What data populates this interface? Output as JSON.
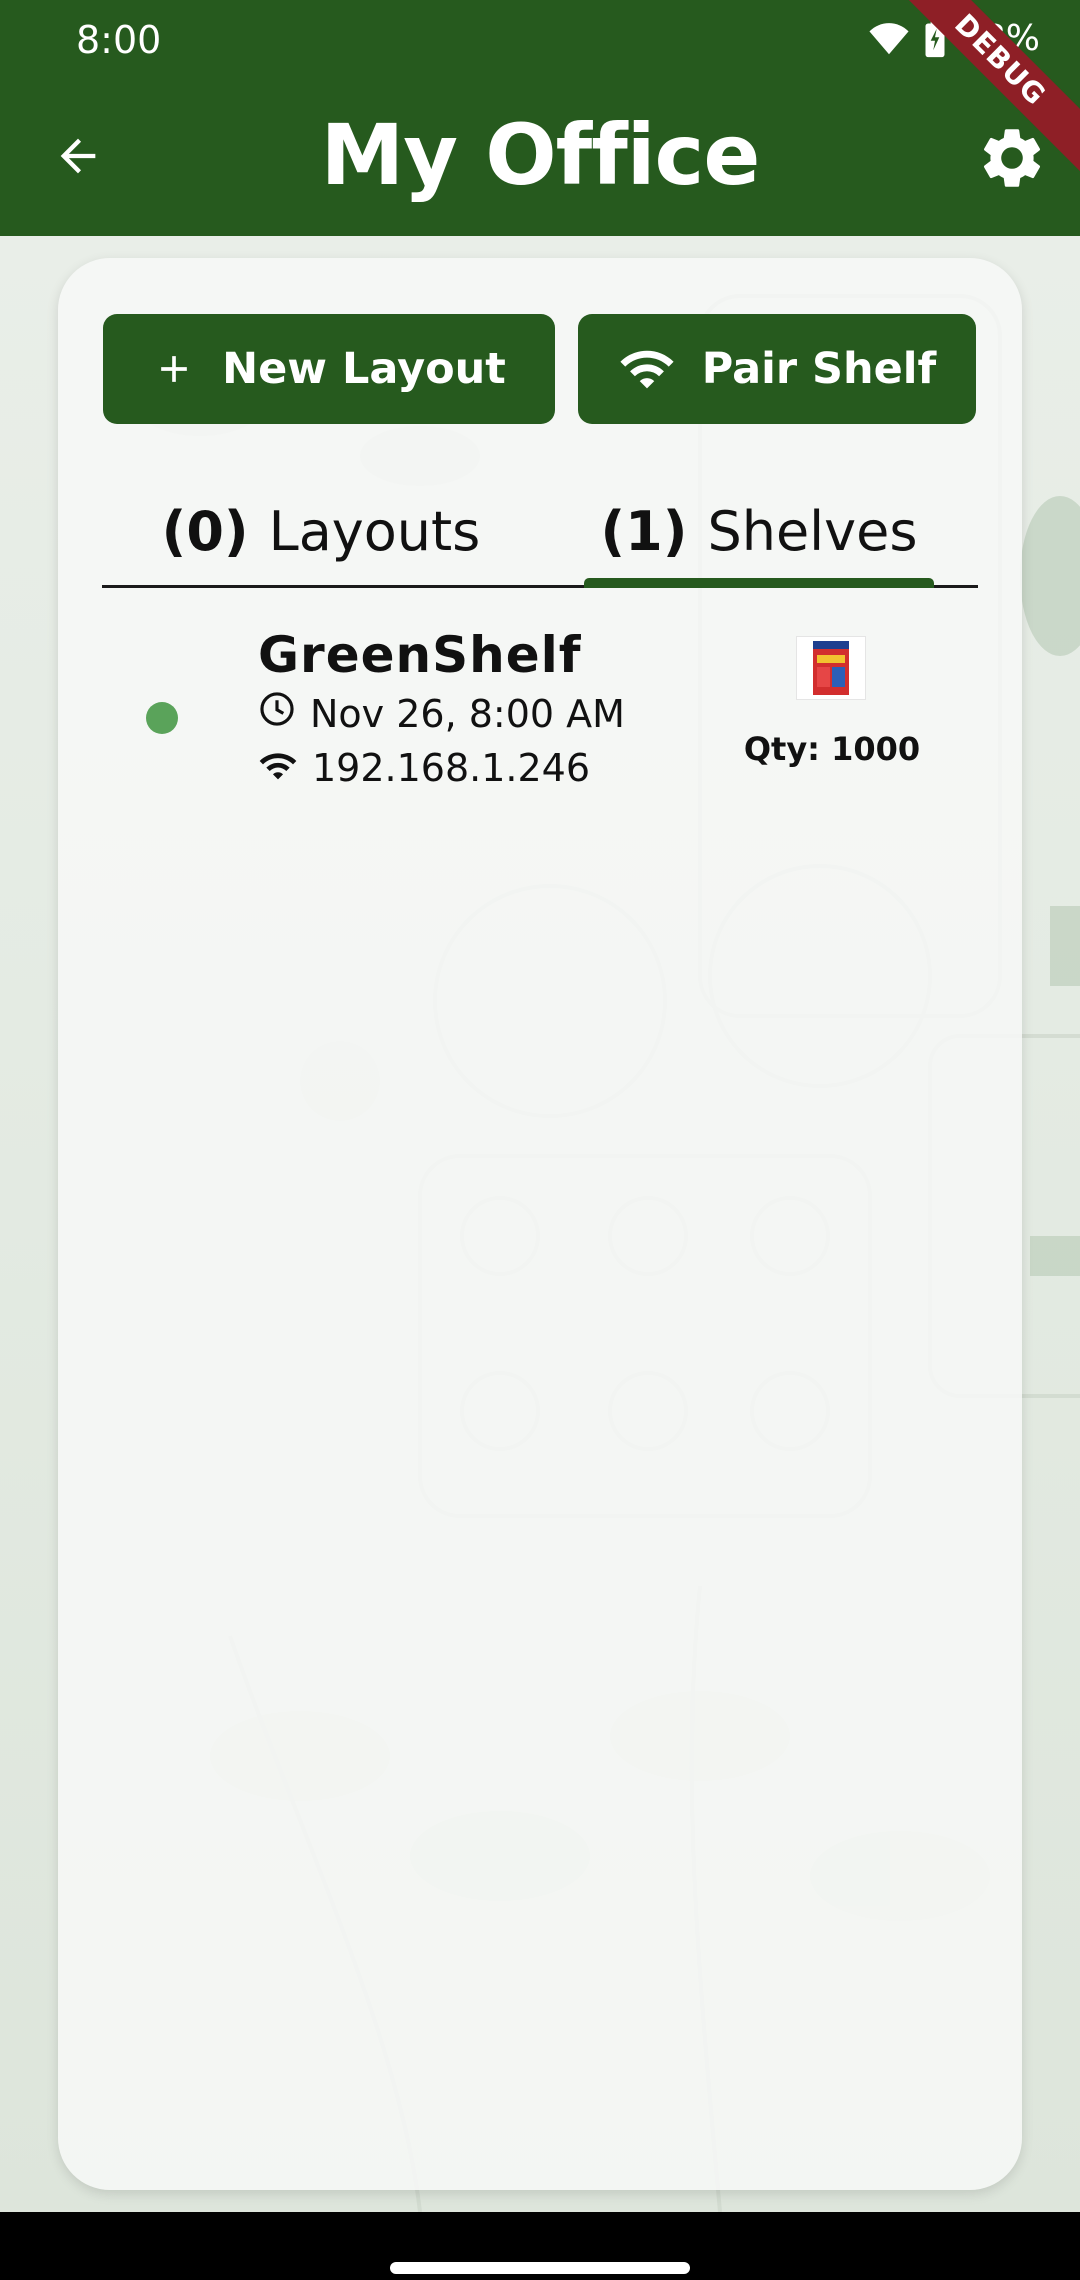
{
  "status_bar": {
    "time": "8:00",
    "battery": "88%",
    "icons": [
      "wifi-icon",
      "battery-charging-icon"
    ]
  },
  "debug_banner": "DEBUG",
  "app_bar": {
    "title": "My Office",
    "back_icon": "arrow-back-icon",
    "settings_icon": "gear-icon"
  },
  "actions": {
    "new_layout_label": "New Layout",
    "pair_shelf_label": "Pair Shelf"
  },
  "tabs": [
    {
      "count": "(0)",
      "label": "Layouts",
      "selected": false
    },
    {
      "count": "(1)",
      "label": "Shelves",
      "selected": true
    }
  ],
  "shelves": [
    {
      "name": "GreenShelf",
      "status": "online",
      "last_seen": "Nov 26, 8:00 AM",
      "ip": "192.168.1.246",
      "qty_label": "Qty: 1000"
    }
  ],
  "colors": {
    "primary": "#265a1e",
    "online": "#5aa35a",
    "debug": "#8e1f26"
  }
}
